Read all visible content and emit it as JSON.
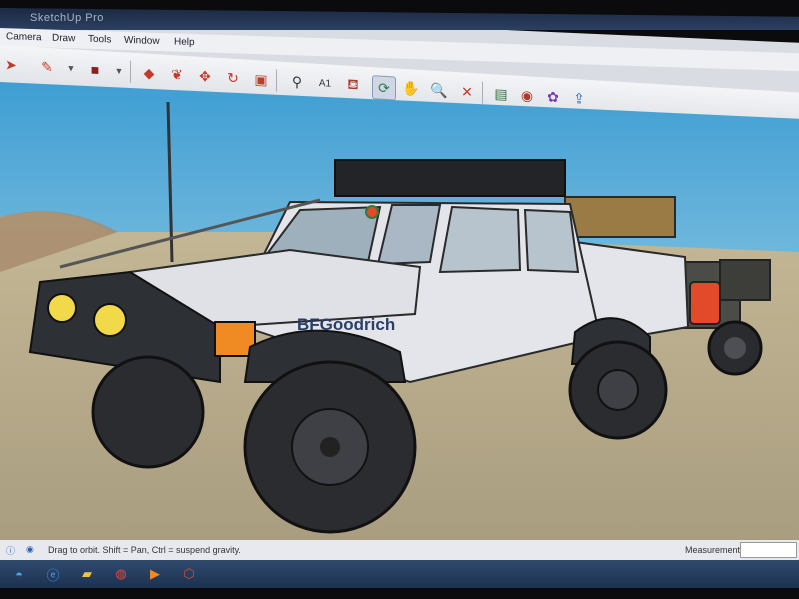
{
  "window": {
    "title": "SketchUp Pro"
  },
  "menu": {
    "items": [
      "Camera",
      "Draw",
      "Tools",
      "Window",
      "Help"
    ]
  },
  "toolbar": {
    "tools": [
      "select-icon",
      "pencil-line-icon",
      "arc-icon",
      "rectangle-icon",
      "push-pull-icon",
      "follow-me-icon",
      "move-icon",
      "rotate-icon",
      "scale-icon",
      "tape-measure-icon",
      "text-label-icon",
      "paint-bucket-icon",
      "orbit-icon",
      "pan-icon",
      "zoom-icon",
      "zoom-extents-icon",
      "components-icon",
      "materials-icon",
      "styles-icon",
      "export-icon"
    ],
    "active_tool": "orbit-icon"
  },
  "model": {
    "vehicle_decal": "BFGoodrich"
  },
  "statusbar": {
    "hint": "Drag to orbit. Shift = Pan, Ctrl = suspend gravity.",
    "measurements_label": "Measurements"
  },
  "taskbar": {
    "apps": [
      "start-icon",
      "internet-explorer-icon",
      "folder-icon",
      "chrome-icon",
      "media-player-icon",
      "sketchup-icon"
    ]
  },
  "colors": {
    "sky_top": "#4fa7d8",
    "ground": "#b9ad8d",
    "truck_body": "#e3e5ea",
    "fender": "#2d3035",
    "lamp": "#f1d94a",
    "turn_signal": "#f08a22",
    "trailer_accent": "#e24a2a"
  }
}
